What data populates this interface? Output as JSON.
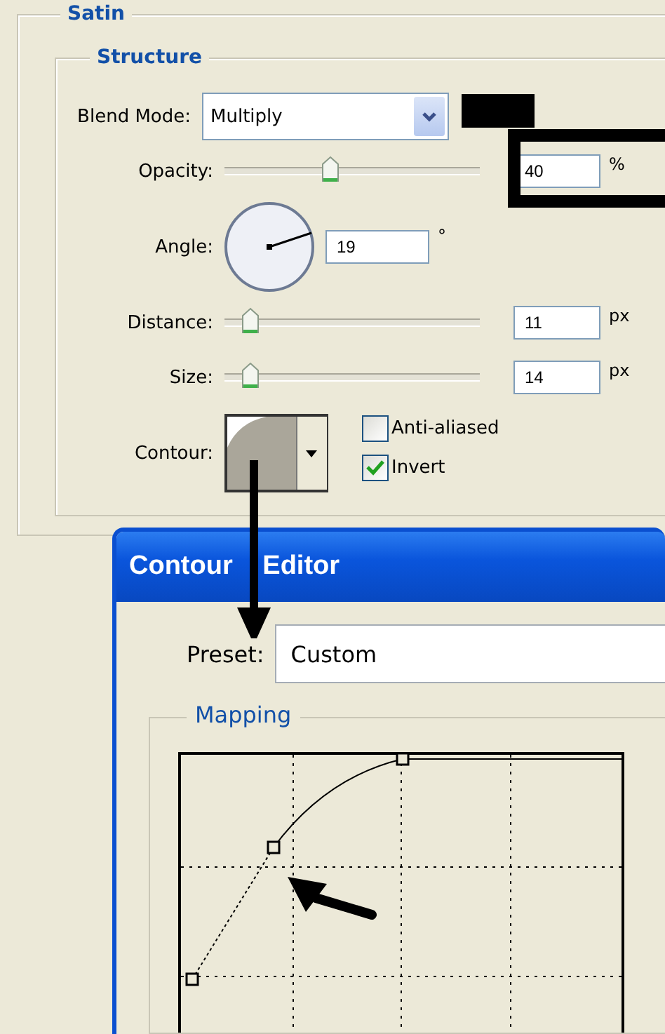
{
  "satin": {
    "legend": "Satin",
    "structure": {
      "legend": "Structure",
      "blend_mode": {
        "label": "Blend Mode:",
        "value": "Multiply"
      },
      "sliders": [
        {
          "label": "Opacity:",
          "level": 0.41,
          "value": "40",
          "unit": "%"
        },
        {
          "kind": "angle",
          "label": "Angle:",
          "value": "19",
          "unit": "°"
        },
        {
          "label": "Distance:",
          "level": 0.1,
          "value": "11",
          "unit": "px"
        },
        {
          "label": "Size:",
          "level": 0.1,
          "value": "14",
          "unit": "px"
        }
      ],
      "contour": {
        "label": "Contour:"
      },
      "checkboxes": [
        {
          "label": "Anti-aliased",
          "checked": false
        },
        {
          "label": "Invert",
          "checked": true
        }
      ]
    }
  },
  "contour_editor": {
    "title": "Contour Editor",
    "preset": {
      "label": "Preset:",
      "value": "Custom"
    },
    "mapping": {
      "legend": "Mapping"
    }
  }
}
